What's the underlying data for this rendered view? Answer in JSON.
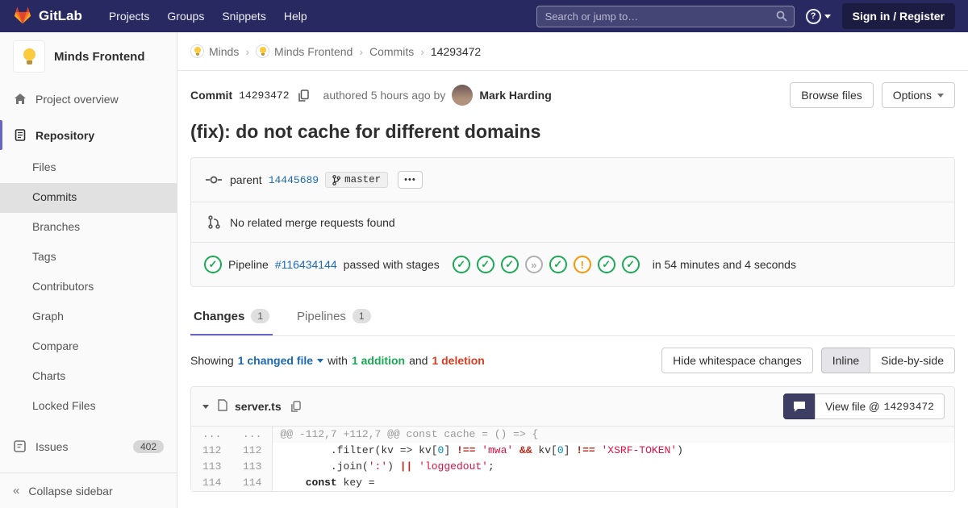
{
  "colors": {
    "navbar_bg": "#292961",
    "accent": "#6666c4",
    "link": "#1b69b6",
    "success": "#1aaa55",
    "danger": "#db3b21",
    "warning": "#fc9403"
  },
  "icons": {
    "pipeline_glyphs": {
      "passed": "✓",
      "skipped": "»",
      "warning": "!"
    }
  },
  "navbar": {
    "brand": "GitLab",
    "menu": [
      "Projects",
      "Groups",
      "Snippets",
      "Help"
    ],
    "search_placeholder": "Search or jump to…",
    "help_label": "?",
    "sign_in": "Sign in / Register"
  },
  "sidebar": {
    "project_name": "Minds Frontend",
    "project_overview": "Project overview",
    "repository": "Repository",
    "repo_items": [
      {
        "label": "Files",
        "active": false
      },
      {
        "label": "Commits",
        "active": true
      },
      {
        "label": "Branches",
        "active": false
      },
      {
        "label": "Tags",
        "active": false
      },
      {
        "label": "Contributors",
        "active": false
      },
      {
        "label": "Graph",
        "active": false
      },
      {
        "label": "Compare",
        "active": false
      },
      {
        "label": "Charts",
        "active": false
      },
      {
        "label": "Locked Files",
        "active": false
      }
    ],
    "issues_label": "Issues",
    "issues_count": "402",
    "collapse_label": "Collapse sidebar"
  },
  "breadcrumb": [
    {
      "label": "Minds",
      "avatar": true,
      "current": false
    },
    {
      "label": "Minds Frontend",
      "avatar": true,
      "current": false
    },
    {
      "label": "Commits",
      "avatar": false,
      "current": false
    },
    {
      "label": "14293472",
      "avatar": false,
      "current": true
    }
  ],
  "commit": {
    "label": "Commit",
    "sha": "14293472",
    "authored_text": "authored 5 hours ago by",
    "author": "Mark Harding",
    "browse_files": "Browse files",
    "options": "Options",
    "title": "(fix): do not cache for different domains",
    "parent_label": "parent",
    "parent_sha": "14445689",
    "branch": "master",
    "no_mr_text": "No related merge requests found",
    "pipeline_label": "Pipeline",
    "pipeline_id": "#116434144",
    "pipeline_status": "passed with stages",
    "pipeline_stages": [
      "passed",
      "passed",
      "passed",
      "skipped",
      "passed",
      "warning",
      "passed",
      "passed"
    ],
    "pipeline_duration": "in 54 minutes and 4 seconds"
  },
  "tabs": [
    {
      "label": "Changes",
      "count": "1",
      "active": true
    },
    {
      "label": "Pipelines",
      "count": "1",
      "active": false
    }
  ],
  "summary": {
    "showing": "Showing",
    "changed_files": "1 changed file",
    "with": "with",
    "additions": "1 addition",
    "and": "and",
    "deletions": "1 deletion",
    "hide_whitespace": "Hide whitespace changes",
    "inline": "Inline",
    "side_by_side": "Side-by-side"
  },
  "file": {
    "name": "server.ts",
    "view_file_label": "View file @",
    "view_file_sha": "14293472",
    "diff_lines": [
      {
        "old": "...",
        "new": "...",
        "kind": "hunk",
        "segments": [
          {
            "t": "@@ -112,7 +112,7 @@ const cache = () => {",
            "c": ""
          }
        ]
      },
      {
        "old": "112",
        "new": "112",
        "kind": "context",
        "segments": [
          {
            "t": "        .filter(kv => kv[",
            "c": ""
          },
          {
            "t": "0",
            "c": "num"
          },
          {
            "t": "] ",
            "c": ""
          },
          {
            "t": "!==",
            "c": "op"
          },
          {
            "t": " ",
            "c": ""
          },
          {
            "t": "'mwa'",
            "c": "str"
          },
          {
            "t": " ",
            "c": ""
          },
          {
            "t": "&&",
            "c": "op"
          },
          {
            "t": " kv[",
            "c": ""
          },
          {
            "t": "0",
            "c": "num"
          },
          {
            "t": "] ",
            "c": ""
          },
          {
            "t": "!==",
            "c": "op"
          },
          {
            "t": " ",
            "c": ""
          },
          {
            "t": "'XSRF-TOKEN'",
            "c": "str"
          },
          {
            "t": ")",
            "c": ""
          }
        ]
      },
      {
        "old": "113",
        "new": "113",
        "kind": "context",
        "segments": [
          {
            "t": "        .join(",
            "c": ""
          },
          {
            "t": "':'",
            "c": "str"
          },
          {
            "t": ") ",
            "c": ""
          },
          {
            "t": "||",
            "c": "op"
          },
          {
            "t": " ",
            "c": ""
          },
          {
            "t": "'loggedout'",
            "c": "str"
          },
          {
            "t": ";",
            "c": ""
          }
        ]
      },
      {
        "old": "114",
        "new": "114",
        "kind": "context",
        "segments": [
          {
            "t": "    ",
            "c": ""
          },
          {
            "t": "const",
            "c": "kw"
          },
          {
            "t": " key =",
            "c": ""
          }
        ]
      }
    ]
  }
}
